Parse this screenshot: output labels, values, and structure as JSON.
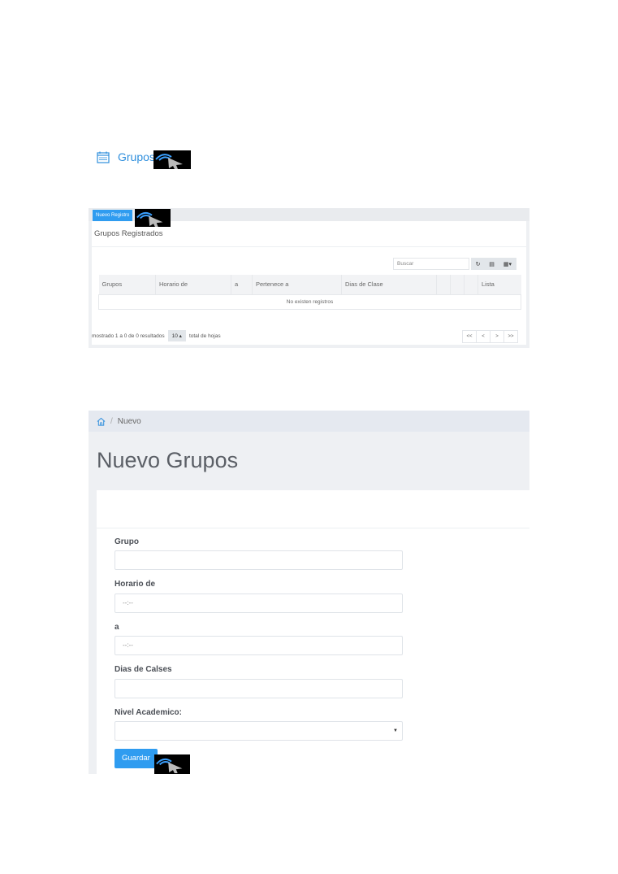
{
  "header": {
    "title": "Grupos",
    "icon": "calendar-icon",
    "color": "#2f8fdd"
  },
  "list_panel": {
    "new_button": "Nuevo Registro",
    "title": "Grupos Registrados",
    "search_placeholder": "Buscar",
    "toolbar": [
      "refresh-icon",
      "toggle-view-icon",
      "columns-icon"
    ],
    "columns": [
      "Grupos",
      "Horario de",
      "a",
      "Pertenece a",
      "Dias de Clase",
      "",
      "",
      "",
      "Lista"
    ],
    "empty_message": "No existen registros",
    "footer": {
      "showing": "mostrado 1 a 0 de 0 resultados",
      "page_size": "10",
      "total": "total de hojas"
    },
    "pager": [
      "<<",
      "<",
      ">",
      ">>"
    ]
  },
  "form_panel": {
    "breadcrumb": {
      "current": "Nuevo"
    },
    "title": "Nuevo Grupos",
    "fields": {
      "grupo": {
        "label": "Grupo",
        "value": ""
      },
      "horario_de": {
        "label": "Horario de",
        "value": "--:--"
      },
      "a": {
        "label": "a",
        "value": "--:--"
      },
      "dias": {
        "label": "Dias de Calses",
        "value": ""
      },
      "nivel": {
        "label": "Nivel Academico:",
        "value": ""
      }
    },
    "submit_label": "Guardar"
  },
  "colors": {
    "accent": "#2f9cf0",
    "panel_bg": "#eef0f3"
  }
}
